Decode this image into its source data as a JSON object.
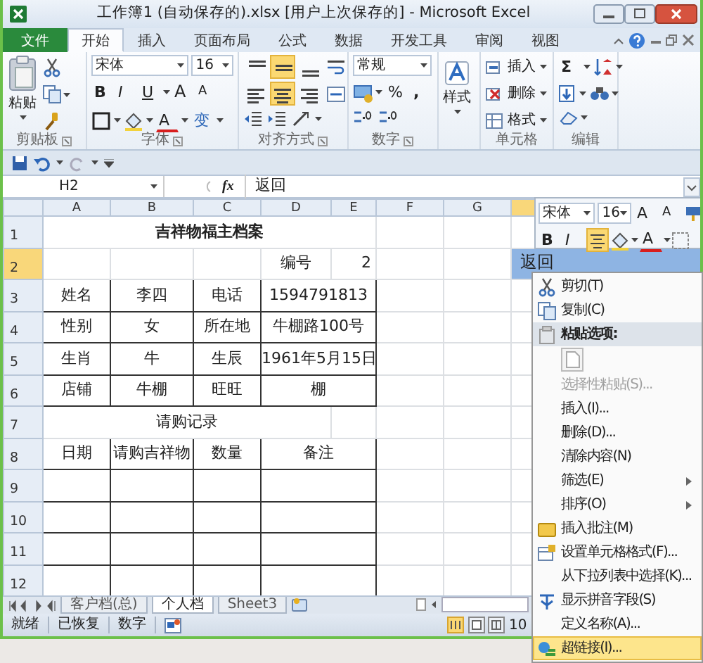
{
  "window": {
    "title": "工作簿1 (自动保存的).xlsx [用户上次保存的]  -  Microsoft Excel"
  },
  "ribbon_tabs": [
    {
      "label": "文件",
      "kind": "file",
      "selected": false
    },
    {
      "label": "开始",
      "kind": "tab",
      "selected": true
    },
    {
      "label": "插入",
      "kind": "tab",
      "selected": false
    },
    {
      "label": "页面布局",
      "kind": "tab",
      "selected": false
    },
    {
      "label": "公式",
      "kind": "tab",
      "selected": false
    },
    {
      "label": "数据",
      "kind": "tab",
      "selected": false
    },
    {
      "label": "开发工具",
      "kind": "tab",
      "selected": false
    },
    {
      "label": "审阅",
      "kind": "tab",
      "selected": false
    },
    {
      "label": "视图",
      "kind": "tab",
      "selected": false
    }
  ],
  "ribbon_groups": [
    {
      "kind": "clipboard",
      "label": "剪贴板",
      "paste_label": "粘贴"
    },
    {
      "kind": "font",
      "label": "字体",
      "font_name": "宋体",
      "font_size": "16",
      "bold": "B",
      "italic": "I",
      "underline": "U",
      "grow": "A",
      "shrink": "A",
      "font_color": "A",
      "phonetic": "变"
    },
    {
      "kind": "alignment",
      "label": "对齐方式",
      "buttons": [
        {
          "kind": "top",
          "selected": false
        },
        {
          "kind": "middle",
          "selected": true
        },
        {
          "kind": "bottom",
          "selected": false
        },
        {
          "kind": "wrap",
          "selected": false
        },
        {
          "kind": "left",
          "selected": false
        },
        {
          "kind": "center",
          "selected": true
        },
        {
          "kind": "right",
          "selected": false
        },
        {
          "kind": "merge",
          "selected": false
        }
      ]
    },
    {
      "kind": "number",
      "label": "数字",
      "format": "常规",
      "percent": "%",
      "comma": ","
    },
    {
      "kind": "styles",
      "button_label": "样式"
    },
    {
      "kind": "cells",
      "label": "单元格",
      "buttons": [
        "插入",
        "删除",
        "格式"
      ]
    },
    {
      "kind": "editing",
      "label": "编辑",
      "sum": "Σ"
    }
  ],
  "formula_bar": {
    "name_box": "H2",
    "function_label": "fx",
    "value": "返回"
  },
  "sheet": {
    "columns": [
      {
        "label": "A",
        "selected": false
      },
      {
        "label": "B",
        "selected": false
      },
      {
        "label": "C",
        "selected": false
      },
      {
        "label": "D",
        "selected": false
      },
      {
        "label": "E",
        "selected": false
      },
      {
        "label": "F",
        "selected": false
      },
      {
        "label": "G",
        "selected": false
      },
      {
        "selected": true
      }
    ],
    "rows": [
      {
        "number": "1",
        "selected": false,
        "cells": [
          {
            "text": "吉祥物福主档案",
            "colspan": 5,
            "kind": "title",
            "bordered": false
          }
        ]
      },
      {
        "number": "2",
        "selected": true,
        "cells": [
          {
            "bordered": false
          },
          {
            "bordered": false
          },
          {
            "bordered": false
          },
          {
            "text": "编号",
            "kind": "text",
            "bordered": false
          },
          {
            "text": "2",
            "kind": "number",
            "bordered": false
          },
          {
            "bordered": false
          },
          {
            "bordered": false
          },
          {
            "text": "返回",
            "kind": "selected",
            "bordered": false
          }
        ]
      },
      {
        "number": "3",
        "selected": false,
        "cells": [
          {
            "text": "姓名",
            "kind": "text",
            "bordered": true
          },
          {
            "text": "李四",
            "kind": "text",
            "bordered": true
          },
          {
            "text": "电话",
            "kind": "text",
            "bordered": true
          },
          {
            "text": "1594791813",
            "colspan": 2,
            "kind": "text",
            "bordered": true
          }
        ]
      },
      {
        "number": "4",
        "selected": false,
        "cells": [
          {
            "text": "性别",
            "kind": "text",
            "bordered": true
          },
          {
            "text": "女",
            "kind": "text",
            "bordered": true
          },
          {
            "text": "所在地",
            "kind": "text",
            "bordered": true
          },
          {
            "text": "牛棚路100号",
            "colspan": 2,
            "kind": "text",
            "bordered": true
          }
        ]
      },
      {
        "number": "5",
        "selected": false,
        "cells": [
          {
            "text": "生肖",
            "kind": "text",
            "bordered": true
          },
          {
            "text": "牛",
            "kind": "text",
            "bordered": true
          },
          {
            "text": "生辰",
            "kind": "text",
            "bordered": true
          },
          {
            "text": "1961年5月15日",
            "colspan": 2,
            "kind": "text",
            "bordered": true
          }
        ]
      },
      {
        "number": "6",
        "selected": false,
        "cells": [
          {
            "text": "店铺",
            "kind": "text",
            "bordered": true
          },
          {
            "text": "牛棚",
            "kind": "text",
            "bordered": true
          },
          {
            "text": "旺旺",
            "kind": "text",
            "bordered": true
          },
          {
            "text": "棚",
            "colspan": 2,
            "kind": "text",
            "bordered": true
          }
        ]
      },
      {
        "number": "7",
        "selected": false,
        "cells": [
          {
            "text": "请购记录",
            "colspan": 4,
            "kind": "text",
            "bordered": false
          }
        ]
      },
      {
        "number": "8",
        "selected": false,
        "cells": [
          {
            "text": "日期",
            "kind": "text",
            "bordered": true
          },
          {
            "text": "请购吉祥物",
            "kind": "text",
            "bordered": true
          },
          {
            "text": "数量",
            "kind": "text",
            "bordered": true
          },
          {
            "text": "备注",
            "colspan": 2,
            "kind": "text",
            "bordered": true
          }
        ]
      },
      {
        "number": "9",
        "selected": false,
        "cells": [
          {
            "bordered": true
          },
          {
            "bordered": true
          },
          {
            "bordered": true
          },
          {
            "colspan": 2,
            "bordered": true
          }
        ]
      },
      {
        "number": "10",
        "selected": false,
        "cells": [
          {
            "bordered": true
          },
          {
            "bordered": true
          },
          {
            "bordered": true
          },
          {
            "colspan": 2,
            "bordered": true
          }
        ]
      },
      {
        "number": "11",
        "selected": false,
        "cells": [
          {
            "bordered": true
          },
          {
            "bordered": true
          },
          {
            "bordered": true
          },
          {
            "colspan": 2,
            "bordered": true
          }
        ]
      },
      {
        "number": "12",
        "selected": false,
        "cells": [
          {
            "bordered": true
          },
          {
            "bordered": true
          },
          {
            "bordered": true
          },
          {
            "colspan": 2,
            "bordered": true
          }
        ]
      }
    ]
  },
  "sheet_tabs": [
    {
      "label": "客户档(总)",
      "selected": false
    },
    {
      "label": "个人档",
      "selected": true
    },
    {
      "label": "Sheet3",
      "selected": false
    }
  ],
  "status_bar": {
    "items": [
      "就绪",
      "已恢复",
      "数字"
    ],
    "zoom": "10"
  },
  "mini_toolbar": {
    "font_name": "宋体",
    "font_size": "16",
    "grow": "A",
    "shrink": "A",
    "bold": "B",
    "italic": "I",
    "center_selected": true,
    "font_color": "A"
  },
  "context_menu": [
    {
      "label": "剪切(T)",
      "kind": "cut",
      "disabled": false,
      "selected": false
    },
    {
      "label": "复制(C)",
      "kind": "copy",
      "disabled": false,
      "selected": false
    },
    {
      "label": "粘贴选项:",
      "kind": "heading",
      "disabled": false,
      "selected": false
    },
    {
      "kind": "paste-option",
      "disabled": false,
      "selected": false
    },
    {
      "label": "选择性粘贴(S)...",
      "kind": "plain",
      "disabled": true,
      "selected": false
    },
    {
      "label": "插入(I)...",
      "kind": "plain",
      "disabled": false,
      "selected": false
    },
    {
      "label": "删除(D)...",
      "kind": "plain",
      "disabled": false,
      "selected": false
    },
    {
      "label": "清除内容(N)",
      "kind": "plain",
      "disabled": false,
      "selected": false
    },
    {
      "label": "筛选(E)",
      "kind": "submenu",
      "disabled": false,
      "selected": false
    },
    {
      "label": "排序(O)",
      "kind": "submenu",
      "disabled": false,
      "selected": false
    },
    {
      "label": "插入批注(M)",
      "kind": "comment",
      "disabled": false,
      "selected": false
    },
    {
      "label": "设置单元格格式(F)...",
      "kind": "format-cells",
      "disabled": false,
      "selected": false
    },
    {
      "label": "从下拉列表中选择(K)...",
      "kind": "plain",
      "disabled": false,
      "selected": false
    },
    {
      "label": "显示拼音字段(S)",
      "kind": "phonetic",
      "disabled": false,
      "selected": false
    },
    {
      "label": "定义名称(A)...",
      "kind": "plain",
      "disabled": false,
      "selected": false
    },
    {
      "label": "超链接(I)...",
      "kind": "hyperlink",
      "disabled": false,
      "selected": true
    }
  ]
}
